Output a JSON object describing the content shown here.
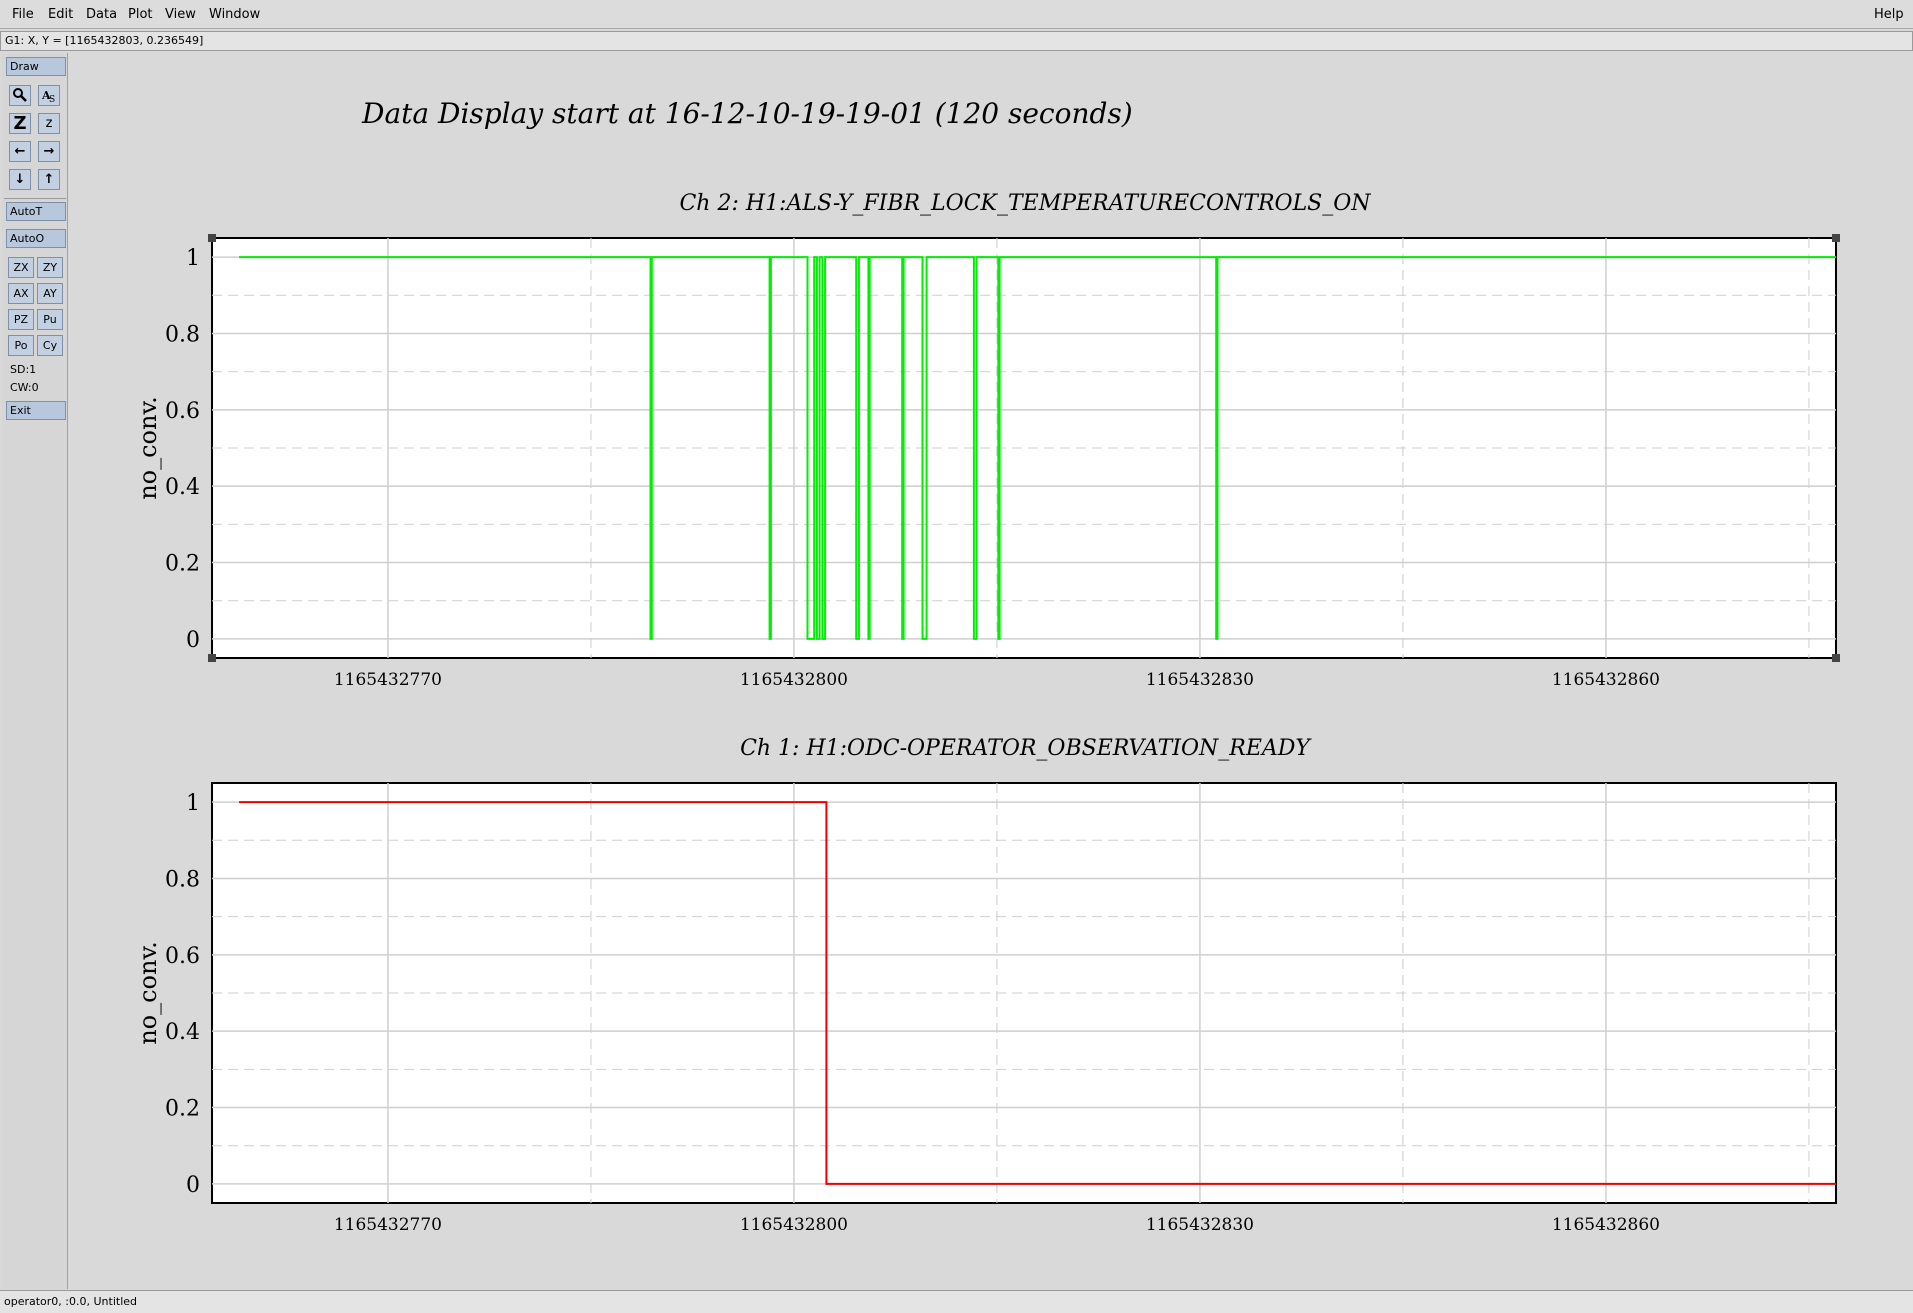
{
  "menubar": {
    "items": [
      {
        "label": "File"
      },
      {
        "label": "Edit"
      },
      {
        "label": "Data"
      },
      {
        "label": "Plot"
      },
      {
        "label": "View"
      },
      {
        "label": "Window"
      }
    ],
    "help": "Help"
  },
  "coord_readout": "G1: X, Y = [1165432803, 0.236549]",
  "toolbar": {
    "draw": "Draw",
    "icons": {
      "magnify": "magnify-icon",
      "text": "text-size-icon",
      "zoom_in": "Z",
      "zoom_out": "z",
      "left": "←",
      "right": "→",
      "down": "↓",
      "up": "↑"
    },
    "autot": "AutoT",
    "autoo": "AutoO",
    "zx": "ZX",
    "zy": "ZY",
    "ax": "AX",
    "ay": "AY",
    "pz": "PZ",
    "pu": "Pu",
    "po": "Po",
    "cy": "Cy",
    "sd": "SD:1",
    "cw": "CW:0",
    "exit": "Exit"
  },
  "main_title": "Data Display start at 16-12-10-19-19-01 (120 seconds)",
  "status": "operator0, :0.0, Untitled",
  "chart_data": [
    {
      "type": "line",
      "step": true,
      "title": "Ch 2: H1:ALS-Y_FIBR_LOCK_TEMPERATURECONTROLS_ON",
      "ylabel": "no_conv.",
      "xlabel": "",
      "color": "#00ee00",
      "xlim": [
        1165432757,
        1165432877
      ],
      "ylim": [
        -0.05,
        1.05
      ],
      "xticks": [
        "1165432770",
        "1165432800",
        "1165432830",
        "1165432860"
      ],
      "xtick_values": [
        1165432770,
        1165432800,
        1165432830,
        1165432860
      ],
      "yticks": [
        "0",
        "0.2",
        "0.4",
        "0.6",
        "0.8",
        "1"
      ],
      "ytick_values": [
        0,
        0.2,
        0.4,
        0.6,
        0.8,
        1
      ],
      "grid": true,
      "points": [
        [
          1165432759.0,
          1
        ],
        [
          1165432789.4,
          1
        ],
        [
          1165432789.4,
          0
        ],
        [
          1165432789.5,
          0
        ],
        [
          1165432789.5,
          1
        ],
        [
          1165432798.2,
          1
        ],
        [
          1165432798.2,
          0
        ],
        [
          1165432798.3,
          0
        ],
        [
          1165432798.3,
          1
        ],
        [
          1165432801.0,
          1
        ],
        [
          1165432801.0,
          0
        ],
        [
          1165432801.5,
          0
        ],
        [
          1165432801.5,
          1
        ],
        [
          1165432801.7,
          1
        ],
        [
          1165432801.7,
          0
        ],
        [
          1165432801.9,
          0
        ],
        [
          1165432801.9,
          1
        ],
        [
          1165432802.1,
          1
        ],
        [
          1165432802.1,
          0
        ],
        [
          1165432802.3,
          0
        ],
        [
          1165432802.3,
          1
        ],
        [
          1165432804.6,
          1
        ],
        [
          1165432804.6,
          0
        ],
        [
          1165432804.8,
          0
        ],
        [
          1165432804.8,
          1
        ],
        [
          1165432805.5,
          1
        ],
        [
          1165432805.5,
          0
        ],
        [
          1165432805.6,
          0
        ],
        [
          1165432805.6,
          1
        ],
        [
          1165432808.0,
          1
        ],
        [
          1165432808.0,
          0
        ],
        [
          1165432808.1,
          0
        ],
        [
          1165432808.1,
          1
        ],
        [
          1165432809.5,
          1
        ],
        [
          1165432809.5,
          0
        ],
        [
          1165432809.8,
          0
        ],
        [
          1165432809.8,
          1
        ],
        [
          1165432813.3,
          1
        ],
        [
          1165432813.3,
          0
        ],
        [
          1165432813.5,
          0
        ],
        [
          1165432813.5,
          1
        ],
        [
          1165432815.1,
          1
        ],
        [
          1165432815.1,
          0
        ],
        [
          1165432815.2,
          0
        ],
        [
          1165432815.2,
          1
        ],
        [
          1165432831.2,
          1
        ],
        [
          1165432831.2,
          0
        ],
        [
          1165432831.3,
          0
        ],
        [
          1165432831.3,
          1
        ],
        [
          1165432877.0,
          1
        ]
      ]
    },
    {
      "type": "line",
      "step": true,
      "title": "Ch 1: H1:ODC-OPERATOR_OBSERVATION_READY",
      "ylabel": "no_conv.",
      "xlabel": "",
      "color": "#ee0000",
      "xlim": [
        1165432757,
        1165432877
      ],
      "ylim": [
        -0.05,
        1.05
      ],
      "xticks": [
        "1165432770",
        "1165432800",
        "1165432830",
        "1165432860"
      ],
      "xtick_values": [
        1165432770,
        1165432800,
        1165432830,
        1165432860
      ],
      "yticks": [
        "0",
        "0.2",
        "0.4",
        "0.6",
        "0.8",
        "1"
      ],
      "ytick_values": [
        0,
        0.2,
        0.4,
        0.6,
        0.8,
        1
      ],
      "grid": true,
      "points": [
        [
          1165432759.0,
          1
        ],
        [
          1165432802.4,
          1
        ],
        [
          1165432802.4,
          0
        ],
        [
          1165432877.0,
          0
        ]
      ]
    }
  ]
}
